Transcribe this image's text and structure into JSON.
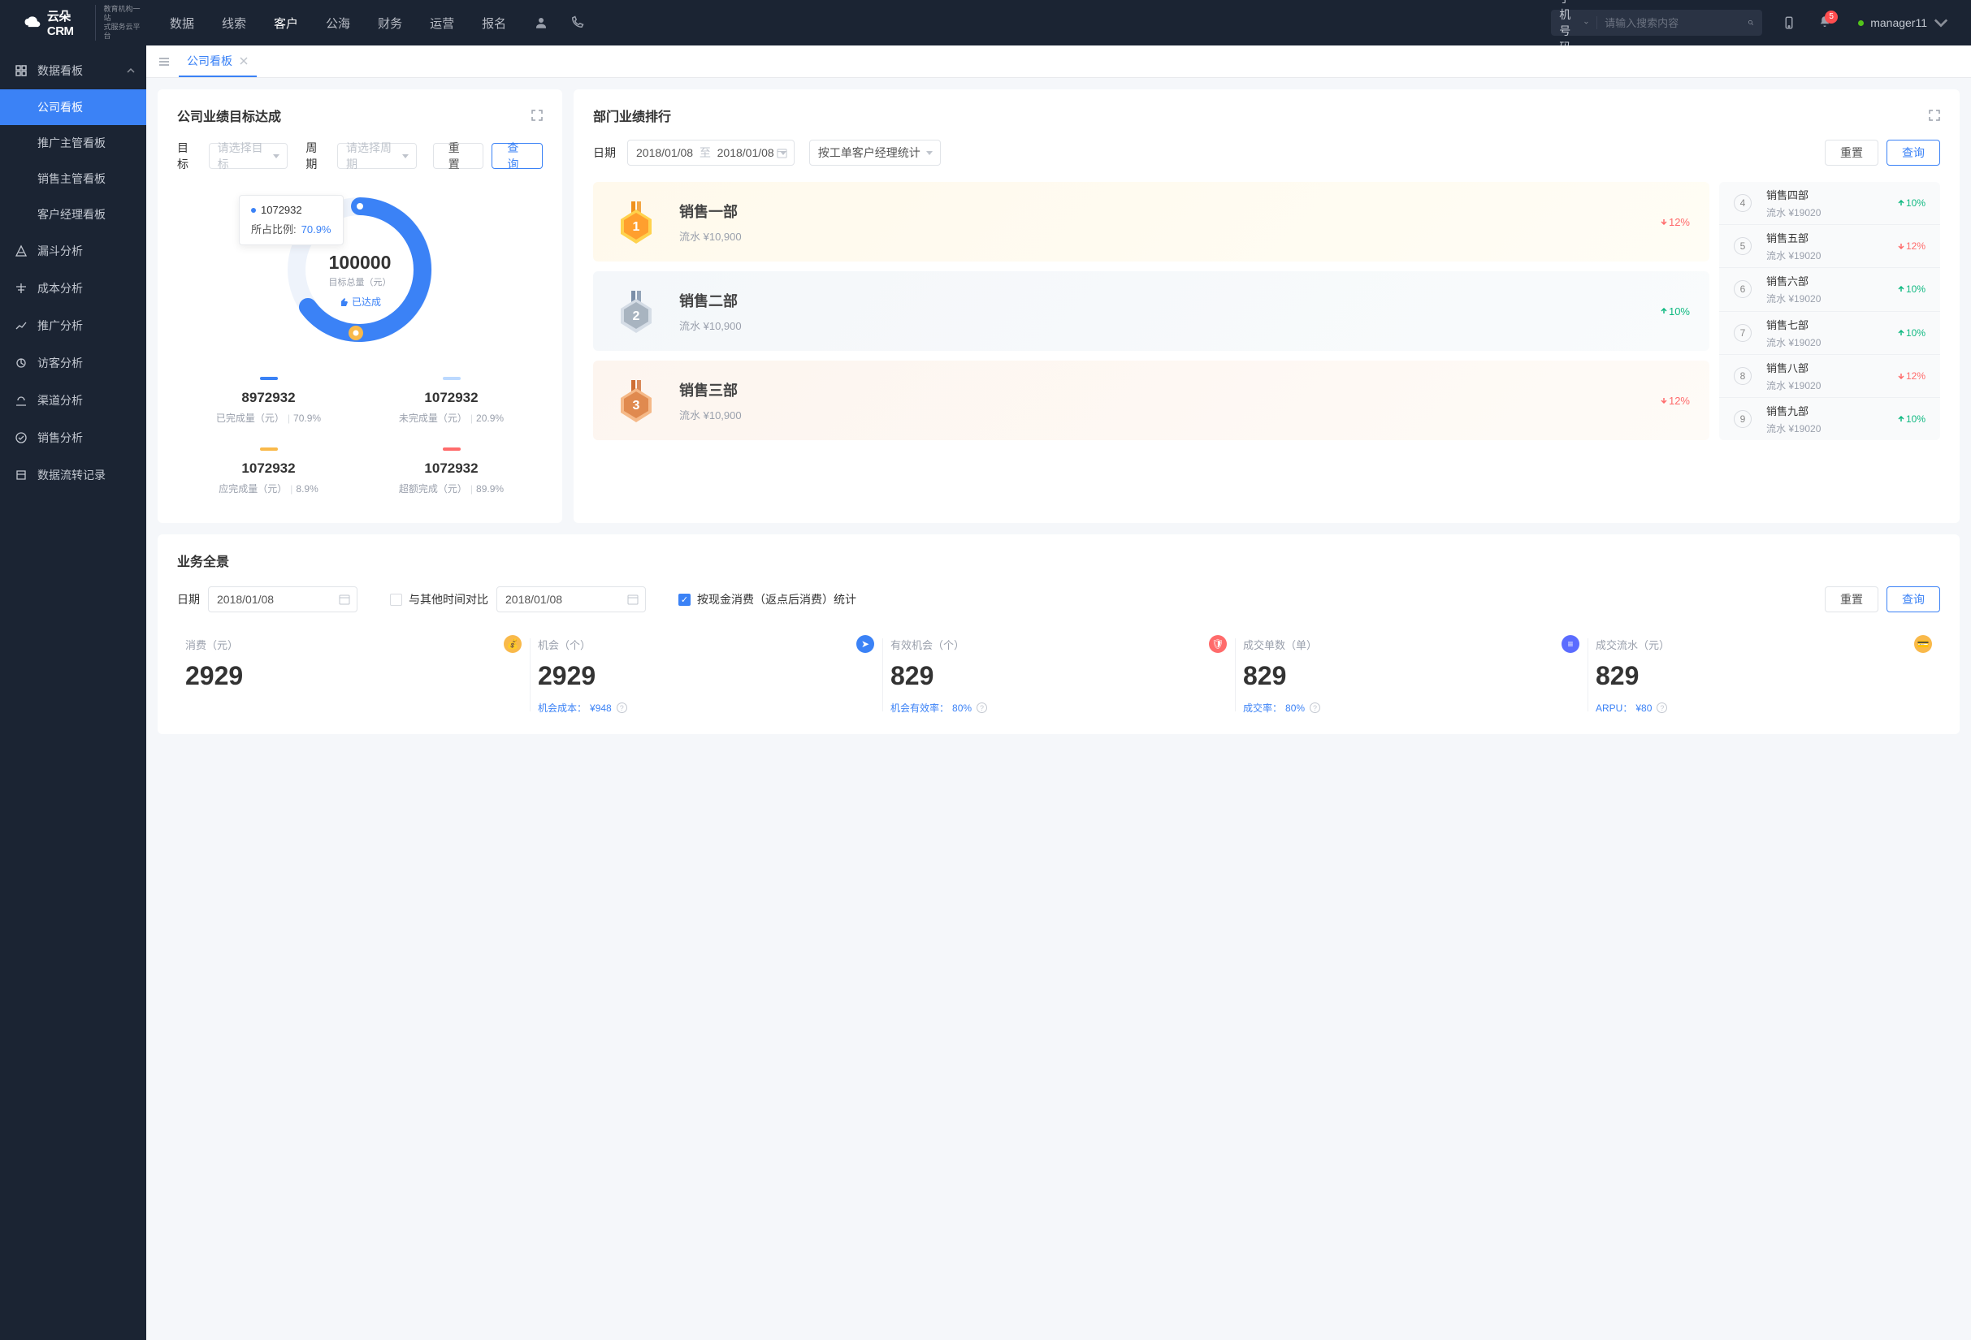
{
  "topnav": {
    "logo": "云朵CRM",
    "logoSub1": "教育机构一站",
    "logoSub2": "式服务云平台",
    "items": [
      "数据",
      "线索",
      "客户",
      "公海",
      "财务",
      "运营",
      "报名"
    ],
    "activeIndex": 2,
    "searchType": "手机号码",
    "searchPlaceholder": "请输入搜索内容",
    "badge": "5",
    "user": "manager11"
  },
  "sidebar": {
    "group": "数据看板",
    "subs": [
      "公司看板",
      "推广主管看板",
      "销售主管看板",
      "客户经理看板"
    ],
    "activeSub": 0,
    "items": [
      "漏斗分析",
      "成本分析",
      "推广分析",
      "访客分析",
      "渠道分析",
      "销售分析",
      "数据流转记录"
    ]
  },
  "tab": {
    "label": "公司看板"
  },
  "achieve": {
    "title": "公司业绩目标达成",
    "goalLabel": "目标",
    "goalPlaceholder": "请选择目标",
    "periodLabel": "周期",
    "periodPlaceholder": "请选择周期",
    "reset": "重置",
    "query": "查询",
    "tooltipValue": "1072932",
    "tooltipRatioLabel": "所占比例:",
    "tooltipRatioValue": "70.9%",
    "centerValue": "100000",
    "centerLabel": "目标总量（元）",
    "achievedLabel": "已达成",
    "stats": [
      {
        "color": "#3b82f6",
        "value": "8972932",
        "label": "已完成量（元）",
        "pct": "70.9%"
      },
      {
        "color": "#bcd9ff",
        "value": "1072932",
        "label": "未完成量（元）",
        "pct": "20.9%"
      },
      {
        "color": "#f9b94a",
        "value": "1072932",
        "label": "应完成量（元）",
        "pct": "8.9%"
      },
      {
        "color": "#ff6b6b",
        "value": "1072932",
        "label": "超额完成（元）",
        "pct": "89.9%"
      }
    ]
  },
  "chart_data": {
    "type": "pie",
    "title": "公司业绩目标达成",
    "total_label": "目标总量（元）",
    "total_value": 100000,
    "series": [
      {
        "name": "已完成量（元）",
        "value": 8972932,
        "pct": 70.9,
        "color": "#3b82f6"
      },
      {
        "name": "未完成量（元）",
        "value": 1072932,
        "pct": 20.9,
        "color": "#bcd9ff"
      },
      {
        "name": "应完成量（元）",
        "value": 1072932,
        "pct": 8.9,
        "color": "#f9b94a"
      },
      {
        "name": "超额完成（元）",
        "value": 1072932,
        "pct": 89.9,
        "color": "#ff6b6b"
      }
    ],
    "highlight": {
      "value": 1072932,
      "pct": 70.9
    }
  },
  "ranking": {
    "title": "部门业绩排行",
    "dateLabel": "日期",
    "dateFrom": "2018/01/08",
    "dateTo": "2018/01/08",
    "to": "至",
    "statBy": "按工单客户经理统计",
    "reset": "重置",
    "query": "查询",
    "top": [
      {
        "name": "销售一部",
        "flowLabel": "流水 ¥10,900",
        "pct": "12%",
        "dir": "down"
      },
      {
        "name": "销售二部",
        "flowLabel": "流水 ¥10,900",
        "pct": "10%",
        "dir": "up"
      },
      {
        "name": "销售三部",
        "flowLabel": "流水 ¥10,900",
        "pct": "12%",
        "dir": "down"
      }
    ],
    "rest": [
      {
        "rank": "4",
        "name": "销售四部",
        "val": "流水 ¥19020",
        "pct": "10%",
        "dir": "up"
      },
      {
        "rank": "5",
        "name": "销售五部",
        "val": "流水 ¥19020",
        "pct": "12%",
        "dir": "down"
      },
      {
        "rank": "6",
        "name": "销售六部",
        "val": "流水 ¥19020",
        "pct": "10%",
        "dir": "up"
      },
      {
        "rank": "7",
        "name": "销售七部",
        "val": "流水 ¥19020",
        "pct": "10%",
        "dir": "up"
      },
      {
        "rank": "8",
        "name": "销售八部",
        "val": "流水 ¥19020",
        "pct": "12%",
        "dir": "down"
      },
      {
        "rank": "9",
        "name": "销售九部",
        "val": "流水 ¥19020",
        "pct": "10%",
        "dir": "up"
      }
    ]
  },
  "panorama": {
    "title": "业务全景",
    "dateLabel": "日期",
    "date1": "2018/01/08",
    "compareLabel": "与其他时间对比",
    "date2": "2018/01/08",
    "checkLabel": "按现金消费（返点后消费）统计",
    "reset": "重置",
    "query": "查询",
    "cells": [
      {
        "label": "消费（元）",
        "value": "2929",
        "foot": "",
        "iconColor": "#f9b94a"
      },
      {
        "label": "机会（个）",
        "value": "2929",
        "footLabel": "机会成本：",
        "footValue": "¥948",
        "iconColor": "#3b82f6"
      },
      {
        "label": "有效机会（个）",
        "value": "829",
        "footLabel": "机会有效率：",
        "footValue": "80%",
        "iconColor": "#ff6b6b"
      },
      {
        "label": "成交单数（单）",
        "value": "829",
        "footLabel": "成交率：",
        "footValue": "80%",
        "iconColor": "#5b6cff"
      },
      {
        "label": "成交流水（元）",
        "value": "829",
        "footLabel": "ARPU：",
        "footValue": "¥80",
        "iconColor": "#f9b94a"
      }
    ]
  }
}
